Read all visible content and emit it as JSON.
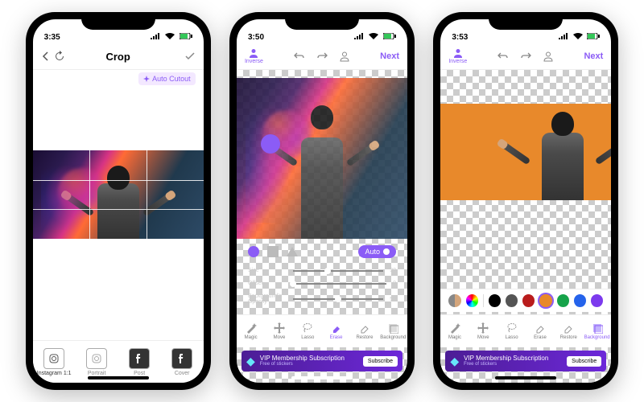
{
  "phone1": {
    "time": "3:35",
    "nav": {
      "title": "Crop"
    },
    "auto_cutout": "Auto Cutout",
    "tabs": [
      {
        "label": "Instagram 1:1"
      },
      {
        "label": "Portrait"
      },
      {
        "label": "Post"
      },
      {
        "label": "Cover"
      }
    ]
  },
  "phone2": {
    "time": "3:50",
    "inverse": "Inverse",
    "next": "Next",
    "auto": "Auto",
    "sliders": {
      "size": {
        "label": "Size",
        "value": "38",
        "max": "100"
      },
      "offset": {
        "label": "Offset",
        "value": "0",
        "max": "100"
      },
      "opacity": {
        "label": "Background's Opacity",
        "value": "50",
        "max": "100"
      }
    },
    "tools": [
      {
        "label": "Magic"
      },
      {
        "label": "Move"
      },
      {
        "label": "Lasso"
      },
      {
        "label": "Erase"
      },
      {
        "label": "Restore"
      },
      {
        "label": "Background"
      }
    ],
    "banner": {
      "title": "VIP Membership Subscription",
      "subtitle": "Free of stickers",
      "cta": "Subscribe"
    }
  },
  "phone3": {
    "time": "3:53",
    "inverse": "Inverse",
    "next": "Next",
    "colors": [
      "#000000",
      "#555555",
      "#b91c1c",
      "#e8892b",
      "#16a34a",
      "#2563eb",
      "#7c3aed"
    ],
    "tools": [
      {
        "label": "Magic"
      },
      {
        "label": "Move"
      },
      {
        "label": "Lasso"
      },
      {
        "label": "Erase"
      },
      {
        "label": "Restore"
      },
      {
        "label": "Background"
      }
    ],
    "banner": {
      "title": "VIP Membership Subscription",
      "subtitle": "Free of stickers",
      "cta": "Subscribe"
    }
  }
}
